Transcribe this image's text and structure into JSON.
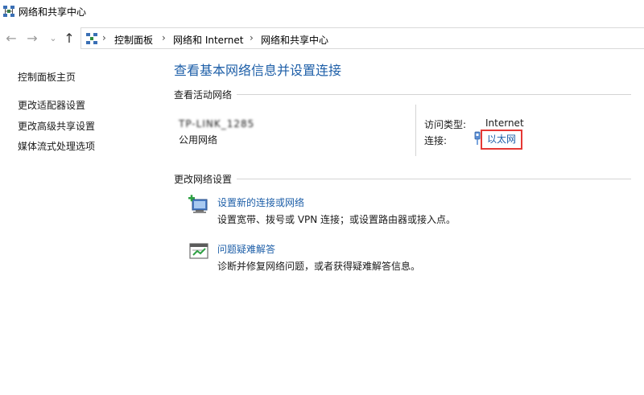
{
  "window": {
    "title": "网络和共享中心"
  },
  "nav": {
    "back": "←",
    "forward": "→",
    "recent": "⌄",
    "up": "↑",
    "breadcrumb": [
      "控制面板",
      "网络和 Internet",
      "网络和共享中心"
    ],
    "separator": "›"
  },
  "sidebar": {
    "home": "控制面板主页",
    "items": [
      "更改适配器设置",
      "更改高级共享设置",
      "媒体流式处理选项"
    ]
  },
  "main": {
    "title": "查看基本网络信息并设置连接",
    "active_section": "查看活动网络",
    "network": {
      "name": "TP-LINK_1285",
      "type": "公用网络",
      "access_label": "访问类型:",
      "access_value": "Internet",
      "connection_label": "连接:",
      "connection_value": "以太网"
    },
    "change_section": "更改网络设置",
    "tasks": [
      {
        "title": "设置新的连接或网络",
        "desc": "设置宽带、拨号或 VPN 连接；或设置路由器或接入点。",
        "icon": "new-connection-icon"
      },
      {
        "title": "问题疑难解答",
        "desc": "诊断并修复网络问题，或者获得疑难解答信息。",
        "icon": "troubleshoot-icon"
      }
    ]
  },
  "colors": {
    "link": "#1e5fa8",
    "highlight": "#e53935"
  }
}
